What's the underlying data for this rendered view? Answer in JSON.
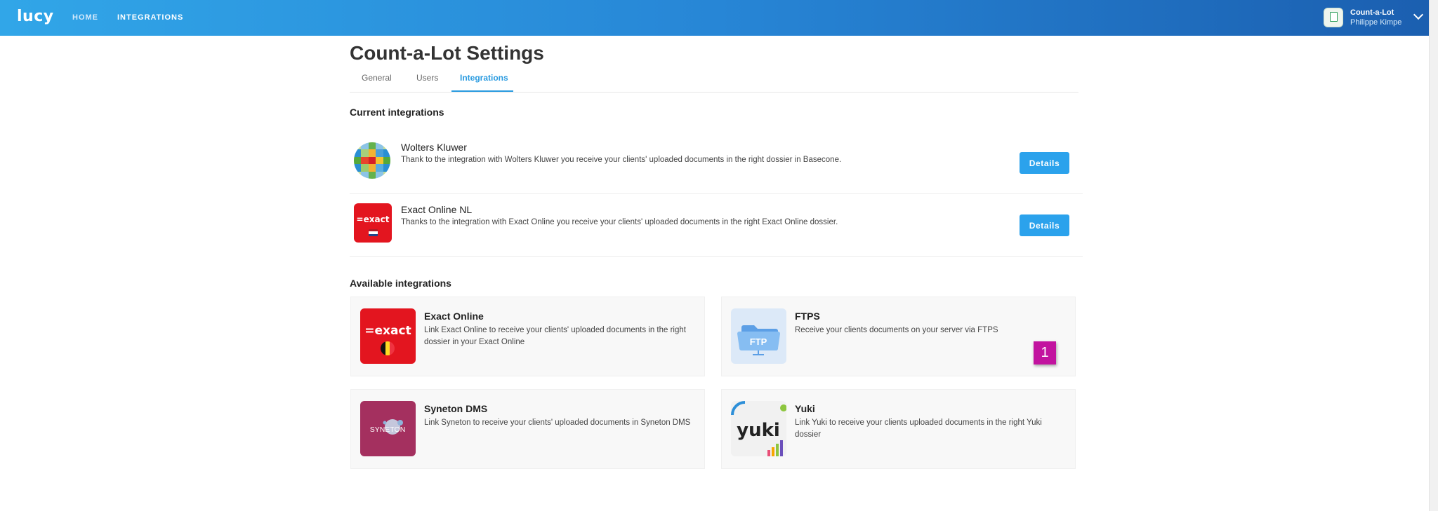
{
  "topbar": {
    "logo": "lucy",
    "nav": {
      "home": "HOME",
      "integrations": "INTEGRATIONS"
    },
    "account": {
      "name": "Count-a-Lot",
      "user": "Philippe Kimpe"
    }
  },
  "page": {
    "title": "Count-a-Lot Settings",
    "tabs": {
      "general": "General",
      "users": "Users",
      "integrations": "Integrations"
    },
    "active_tab": "Integrations"
  },
  "current": {
    "heading": "Current integrations",
    "items": [
      {
        "name": "Wolters Kluwer",
        "description": "Thank to the integration with Wolters Kluwer you receive your clients' uploaded documents in the right dossier in Basecone.",
        "button": "Details",
        "icon": "wolters-kluwer-logo"
      },
      {
        "name": "Exact Online NL",
        "description": "Thanks to the integration with Exact Online you receive your clients' uploaded documents in the right Exact Online dossier.",
        "button": "Details",
        "icon": "exact-online-nl-logo",
        "logo_text": "=exact"
      }
    ]
  },
  "available": {
    "heading": "Available integrations",
    "items": [
      {
        "name": "Exact Online",
        "description": "Link Exact Online to receive your clients' uploaded documents in the right dossier in your Exact Online",
        "icon": "exact-online-be-logo",
        "logo_text": "=exact"
      },
      {
        "name": "FTPS",
        "description": "Receive your clients documents on your server via FTPS",
        "icon": "ftp-folder-icon",
        "logo_text": "FTP"
      },
      {
        "name": "Syneton DMS",
        "description": "Link Syneton to receive your clients' uploaded documents in Syneton DMS",
        "icon": "syneton-logo",
        "logo_text": "SYNETON"
      },
      {
        "name": "Yuki",
        "description": "Link Yuki to receive your clients uploaded documents in the right Yuki dossier",
        "icon": "yuki-logo",
        "logo_text": "yuki"
      }
    ]
  },
  "badge": "1",
  "colors": {
    "accent": "#2ba2ec",
    "topbar_start": "#31a6e8",
    "topbar_end": "#1b5fb0",
    "exact_red": "#e3151f",
    "syneton": "#a4305f",
    "badge": "#c2139f"
  }
}
